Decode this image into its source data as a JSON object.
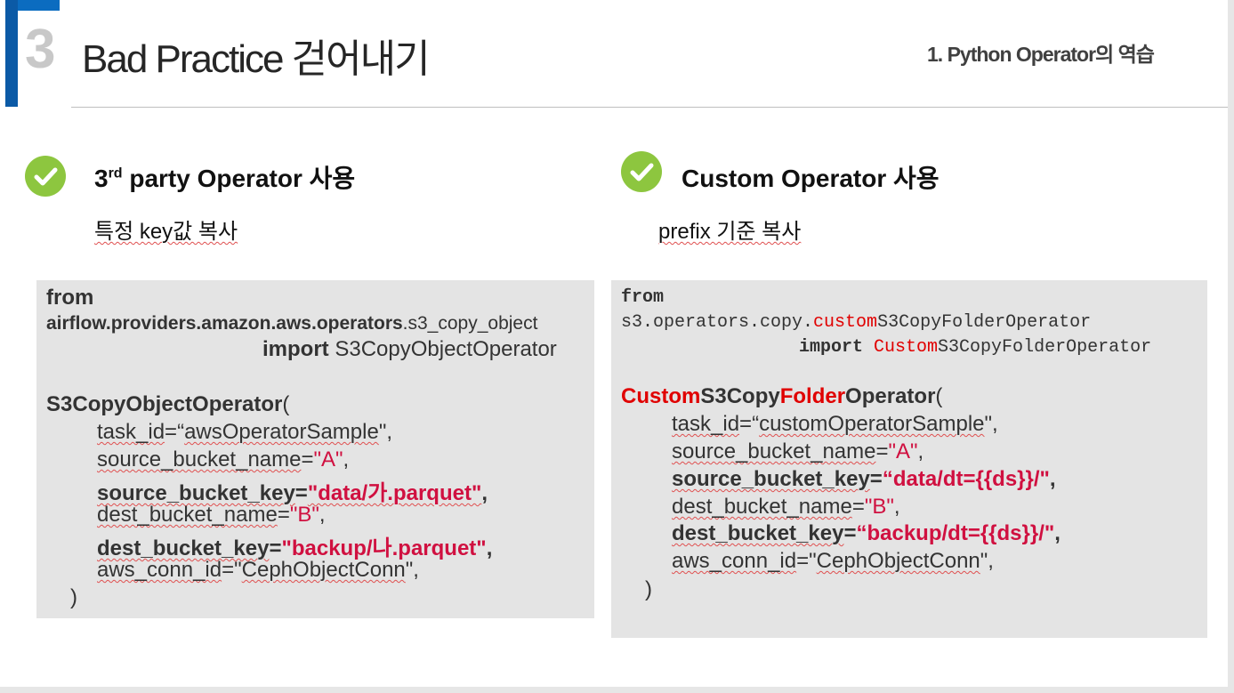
{
  "header": {
    "section_number": "3",
    "title": "Bad Practice 걷어내기",
    "subtitle": "1.   Python Operator의 역습"
  },
  "left": {
    "heading_prefix": "3",
    "heading_sup": "rd",
    "heading_rest": " party Operator 사용",
    "sub": "특정 key값 복사",
    "code": {
      "l1": "from",
      "l2a": "airflow.providers.amazon.aws.operators",
      "l2b": ".s3_copy_object",
      "l3a": "import",
      "l3b": " S3CopyObjectOperator",
      "l4a": "S3CopyObjectOperator",
      "l4b": "(",
      "l5a": "task_id",
      "l5b": "=“",
      "l5c": "awsOperatorSample",
      "l5d": "\",",
      "l6a": "source_bucket_name",
      "l6b": "=",
      "l6c": "\"A\"",
      "l6d": ",",
      "l7a": "source_bucket_key",
      "l7b": "=",
      "l7c": "\"data/가.parquet\"",
      "l7d": ",",
      "l8a": "dest_bucket_name",
      "l8b": "=",
      "l8c": "\"B\"",
      "l8d": ",",
      "l9a": "dest_bucket_key",
      "l9b": "=",
      "l9c": "\"backup/나.parquet\"",
      "l9d": ",",
      "l10a": "aws_conn_id",
      "l10b": "=\"",
      "l10c": "CephObjectConn",
      "l10d": "\",",
      "l11": ")"
    }
  },
  "right": {
    "heading": "Custom Operator 사용",
    "sub": "prefix 기준 복사",
    "code": {
      "l1": "from",
      "l2a": "s3.operators.copy.",
      "l2b": "custom",
      "l2c": "S3CopyFolderOperator",
      "l3a": "import",
      "l3b": " ",
      "l3c": "Custom",
      "l3d": "S3CopyFolderOperator",
      "l4a": "Custom",
      "l4b": "S3Copy",
      "l4c": "Folder",
      "l4d": "Operator",
      "l4e": "(",
      "l5a": "task_id",
      "l5b": "=“",
      "l5c": "customOperatorSample",
      "l5d": "\",",
      "l6a": "source_bucket_name",
      "l6b": "=",
      "l6c": "\"A\"",
      "l6d": ",",
      "l7a": "source_bucket_key",
      "l7b": "=",
      "l7c": "“data/dt={{ds}}/\"",
      "l7d": ",",
      "l8a": "dest_bucket_name",
      "l8b": "=",
      "l8c": "\"B\"",
      "l8d": ",",
      "l9a": "dest_bucket_key",
      "l9b": "=",
      "l9c": "“backup/dt={{ds}}/\"",
      "l9d": ",",
      "l10a": "aws_conn_id",
      "l10b": "=\"",
      "l10c": "CephObjectConn",
      "l10d": "\",",
      "l11": ")"
    }
  },
  "colors": {
    "accent": "#0b5aa6",
    "check": "#8dc63f",
    "code_bg": "#e4e4e4",
    "highlight_red": "#e00000",
    "highlight_crimson": "#d01040"
  },
  "icons": [
    "check-circle-icon",
    "check-circle-icon"
  ]
}
